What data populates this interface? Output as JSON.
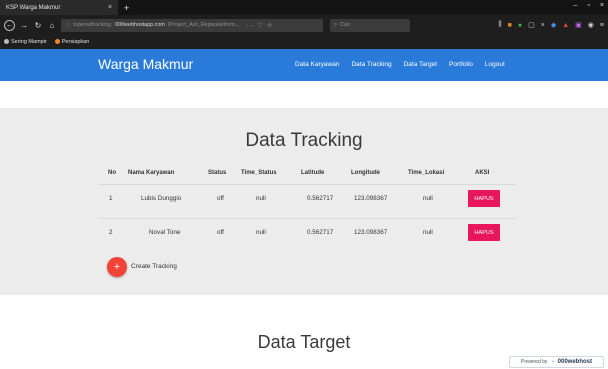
{
  "browser": {
    "tab_title": "KSP Warga Makmur",
    "tab_close": "×",
    "new_tab": "+",
    "window_controls": [
      "–",
      "▫",
      "×"
    ],
    "url_prefix": "toperadtracking.",
    "url_host": "000webhostapp.com",
    "url_path": "/Project_Asli_Reparasi/form...",
    "url_actions": "··· ♡ ☆",
    "search_placeholder": "Cari",
    "bookmarks": [
      {
        "label": "Sering Mampir",
        "icon": "gear-icon"
      },
      {
        "label": "Persiapkan",
        "icon": "firefox-icon",
        "color": "#f08a24"
      }
    ]
  },
  "site": {
    "brand": "Warga Makmur",
    "nav": [
      "Data Karyawan",
      "Data Tracking",
      "Data Target",
      "Portfolio",
      "Logout"
    ],
    "accent": "#2a7bd9"
  },
  "tracking": {
    "title": "Data Tracking",
    "columns": [
      "No",
      "Nama Karyawan",
      "Status",
      "Time_Status",
      "Latitude",
      "Longitude",
      "Time_Lokasi",
      "AKSI"
    ],
    "rows": [
      {
        "no": "1",
        "nama": "Lubis Dunggio",
        "status": "off",
        "time_status": "null",
        "latitude": "0.562717",
        "longitude": "123.098367",
        "time_lokasi": "null",
        "aksi": "HAPUS"
      },
      {
        "no": "2",
        "nama": "Noval Tone",
        "status": "off",
        "time_status": "null",
        "latitude": "0.562717",
        "longitude": "123.098367",
        "time_lokasi": "null",
        "aksi": "HAPUS"
      }
    ],
    "create_icon": "+",
    "create_label": "Create Tracking",
    "hapus_color": "#e8175d"
  },
  "target": {
    "title": "Data Target"
  },
  "badge": {
    "powered_by": "Powered by",
    "brand": "000webhost"
  }
}
